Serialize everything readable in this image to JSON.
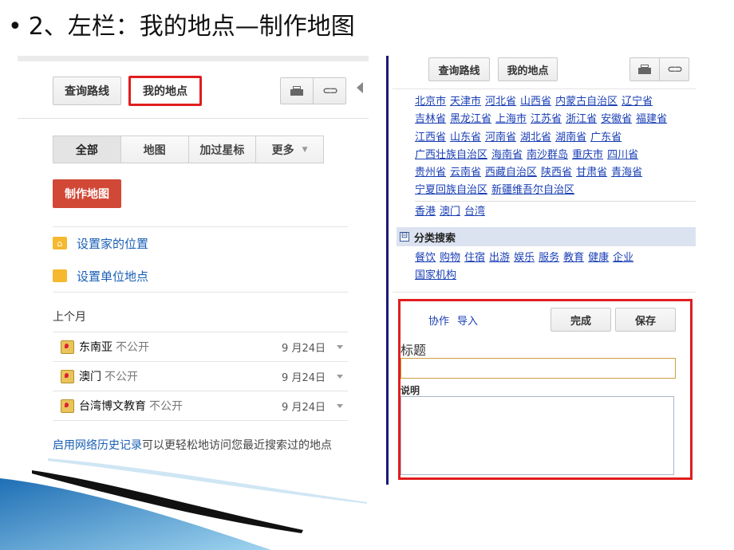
{
  "slide": {
    "bullet": "•",
    "title": "2、左栏：我的地点—制作地图"
  },
  "left": {
    "toolbar": {
      "route": "查询路线",
      "my_places": "我的地点"
    },
    "tabs": [
      {
        "label": "全部"
      },
      {
        "label": "地图"
      },
      {
        "label": "加过星标"
      },
      {
        "label": "更多"
      }
    ],
    "create_map": "制作地图",
    "set_home": "设置家的位置",
    "set_work": "设置单位地点",
    "section": "上个月",
    "maps": [
      {
        "name": "东南亚",
        "privacy": "不公开",
        "date": "9 月24日"
      },
      {
        "name": "澳门",
        "privacy": "不公开",
        "date": "9 月24日"
      },
      {
        "name": "台湾博文教育",
        "privacy": "不公开",
        "date": "9 月24日"
      }
    ],
    "history_link": "启用网络历史记录",
    "history_text": "可以更轻松地访问您最近搜索过的地点"
  },
  "right": {
    "toolbar": {
      "route": "查询路线",
      "my_places": "我的地点"
    },
    "provinces": [
      [
        "北京市",
        "天津市",
        "河北省",
        "山西省",
        "内蒙古自治区",
        "辽宁省"
      ],
      [
        "吉林省",
        "黑龙江省",
        "上海市",
        "江苏省",
        "浙江省",
        "安徽省",
        "福建省"
      ],
      [
        "江西省",
        "山东省",
        "河南省",
        "湖北省",
        "湖南省",
        "广东省"
      ],
      [
        "广西壮族自治区",
        "海南省",
        "南沙群岛",
        "重庆市",
        "四川省"
      ],
      [
        "贵州省",
        "云南省",
        "西藏自治区",
        "陕西省",
        "甘肃省",
        "青海省"
      ],
      [
        "宁夏回族自治区",
        "新疆维吾尔自治区"
      ]
    ],
    "regions": [
      "香港",
      "澳门",
      "台湾"
    ],
    "category_toggle": "⊟",
    "category_title": "分类搜索",
    "categories": [
      [
        "餐饮",
        "购物",
        "住宿",
        "出游",
        "娱乐",
        "服务",
        "教育",
        "健康",
        "企业"
      ],
      [
        "国家机构"
      ]
    ],
    "form": {
      "collab": "协作",
      "import": "导入",
      "done": "完成",
      "save": "保存",
      "title_label": "标题",
      "title_value": "",
      "desc_label": "说明",
      "desc_value": ""
    }
  },
  "colors": {
    "accent_red": "#d14836",
    "highlight_border": "#e01e1e",
    "link_blue": "#1a3fb5"
  },
  "icons": [
    "print-icon",
    "link-icon",
    "home-icon",
    "work-icon",
    "map-pin-icon",
    "collapse-arrow-icon"
  ]
}
